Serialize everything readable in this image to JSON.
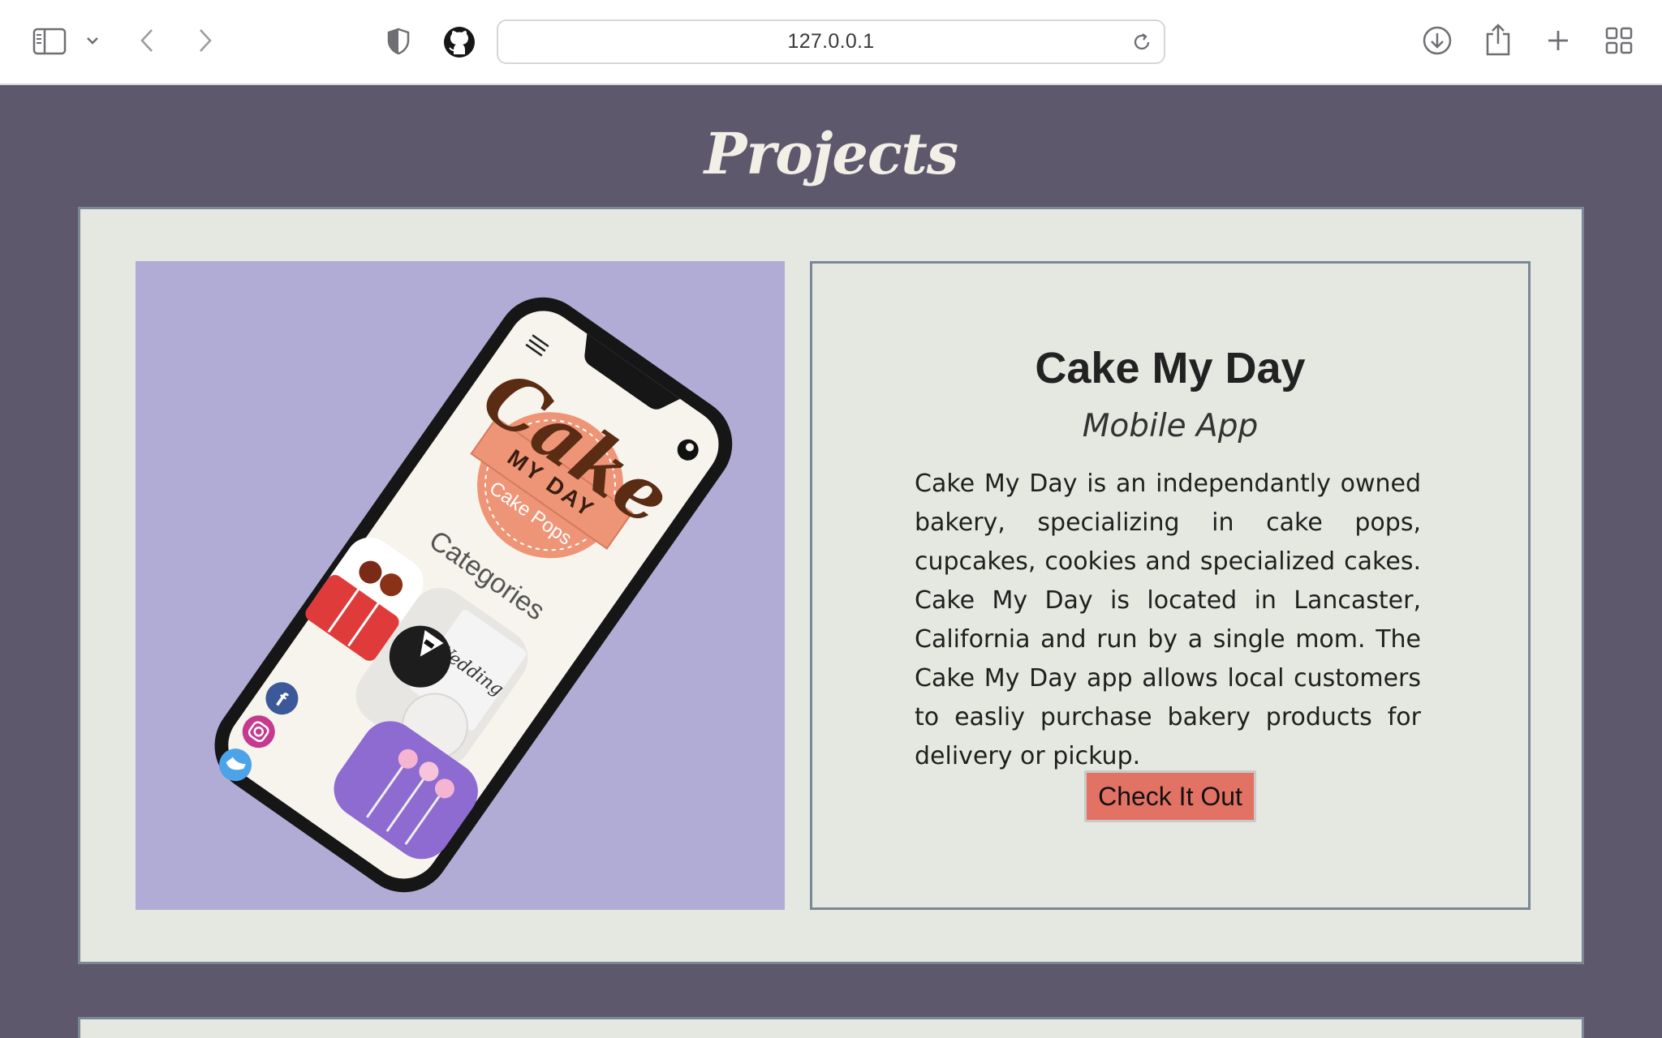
{
  "browser": {
    "url": "127.0.0.1",
    "icons": [
      "sidebar-icon",
      "chevron-down-icon",
      "back-icon",
      "forward-icon",
      "shield-icon",
      "github-icon",
      "reload-icon",
      "download-icon",
      "share-icon",
      "new-tab-icon",
      "tab-overview-icon"
    ]
  },
  "page": {
    "section_title": "Projects"
  },
  "project": {
    "title": "Cake My Day",
    "subtitle": "Mobile App",
    "description": "Cake My Day is an independantly owned bakery, specializing in cake pops, cupcakes, cookies and specialized cakes. Cake My Day is located in Lancaster, California and run by a single mom. The Cake My Day app allows local customers to easliy purchase bakery products for delivery or pickup.",
    "button_label": "Check It Out",
    "mockup": {
      "logo_word": "Cake",
      "logo_tag": "MY DAY",
      "logo_sub": "Cake Pops",
      "heading": "Categories",
      "category_label": "Wedding"
    }
  },
  "colors": {
    "page_bg": "#5d586c",
    "card_bg": "#e5e8e0",
    "card_border": "#7a8797",
    "image_bg": "#b0acd6",
    "button_bg": "#e27263",
    "title_color": "#f1efe6"
  }
}
